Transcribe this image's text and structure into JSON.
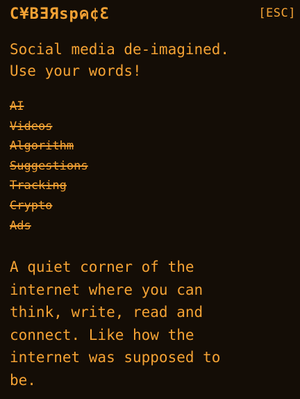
{
  "header": {
    "logo_text": "C¥BƎЯspค¢Ɛ",
    "esc_label": "[ESC]"
  },
  "tagline": {
    "lines": [
      "Social media de-imagined.",
      "Use your words!"
    ]
  },
  "rejected_features": [
    "AI",
    "Videos",
    "Algorithm",
    "Suggestions",
    "Tracking",
    "Crypto",
    "Ads"
  ],
  "about": {
    "lines": [
      "A quiet corner of the",
      "internet where you can",
      "think, write, read and",
      "connect. Like how the",
      "internet was supposed to",
      "be."
    ]
  },
  "colors": {
    "background": "#140d06",
    "accent": "#f4a234"
  }
}
